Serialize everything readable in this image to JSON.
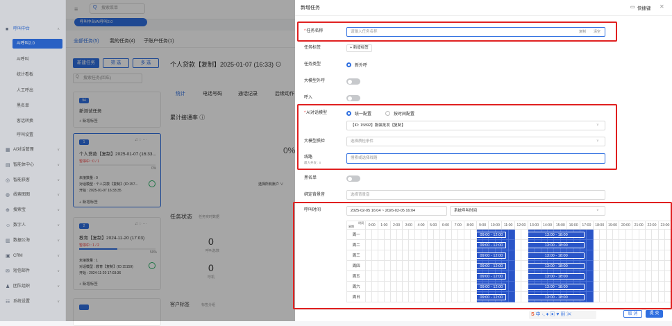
{
  "topbar": {
    "search_placeholder": "搜索菜单",
    "breadcrumb": "呼叫中台/AI呼叫2.0"
  },
  "sidebar": {
    "group": "呼叫中台",
    "subitems": [
      "AI呼叫2.0",
      "AI呼叫",
      "统计看板",
      "人工呼出",
      "黑名单",
      "客话转换",
      "呼叫设置"
    ],
    "items": [
      "AI对话管理",
      "智能体中心",
      "智能获客",
      "线索图图",
      "搜索宝",
      "数字人",
      "数据公海",
      "CRM",
      "短信邮件",
      "团队组织",
      "系统设置"
    ]
  },
  "bg": {
    "tabs": [
      "全部任务(5)",
      "我的任务(4)",
      "子账户任务(1)"
    ],
    "new_task": "新建任务",
    "filter": "筛 选",
    "multi": "多 选",
    "search_placeholder": "搜索任务(回车)",
    "card1": {
      "badge": "94",
      "title": "新测试任务",
      "add": "+ 新增标签"
    },
    "card2": {
      "badge": "1",
      "title": "个人贷款【复制】2025-01-07 (16:33...",
      "progress": "暂停中 : 0 / 1",
      "pct": "0%",
      "l1": "未接数量 : 0",
      "l2": "对话模型 : 个人贷款【复制】(ID:157...",
      "l3": "开始 : 2025-01-07 16:33:35",
      "add": "+ 新增标签"
    },
    "card3": {
      "badge": "2",
      "title": "教育【复制】2024-11-20 (17:03)",
      "progress": "暂停中 : 1 / 2",
      "pct": "50%",
      "l1": "未接数量 : 1",
      "l2": "对话模型 : 教育【复制】(ID:15159)",
      "l3": "开始 : 2024-11-20 17:03:36",
      "add": "+ 新增标签"
    },
    "detail_title": "个人贷款【复制】2025-01-07 (16:33) ⊙",
    "detail_tabs": [
      "统计",
      "电话号码",
      "通话记录",
      "后续动作"
    ],
    "stat_title": "累计接通率 ⓘ",
    "pct0": "0%",
    "task_status": "任务状态",
    "task_status_sub": "任务实时数据",
    "n1": "0",
    "n1_lbl": "呼叫总数",
    "n2": "0",
    "n2_lbl": "呼机",
    "customer_tag": "客户标签",
    "customer_tag_sub": "标签分组",
    "select_all": "选择所有账户 ∨"
  },
  "panel": {
    "title": "新增任务",
    "shortcut": "快捷键",
    "close": "✕",
    "task_name_label": "任务名称",
    "task_name_placeholder": "请输入任务名称",
    "copy": "复制",
    "clear": "清空",
    "task_tag_label": "任务标签",
    "task_tag_btn": "+ 新增标签",
    "task_type_label": "任务类型",
    "task_type_value": "新外呼",
    "llm_call_label": "大模型外呼",
    "inbound_label": "呼入",
    "ai_model_label": "AI对话模型",
    "radio_unified": "统一配置",
    "radio_by_time": "按时间配置",
    "model_value": "【ID: 15892】服装批发【复制】",
    "llm_qc_label": "大模型质检",
    "llm_qc_placeholder": "选择质检条件",
    "line_label": "线路",
    "line_sub": "最大并发 : 0",
    "line_placeholder": "搜索或选择线路",
    "blacklist_label": "黑名单",
    "bind_bg_label": "绑定背景音",
    "bind_bg_placeholder": "选择背景音",
    "call_time_label": "呼叫时间",
    "date_range": "2025-02-05 16:04  ~  2026-02-05 16:04",
    "call_time_select": "系统呼叫时间",
    "grid_corner_time": "时间",
    "grid_corner_week": "星期",
    "hours": [
      "0:00",
      "1:00",
      "2:00",
      "3:00",
      "4:00",
      "5:00",
      "6:00",
      "7:00",
      "8:00",
      "9:00",
      "10:00",
      "11:00",
      "12:00",
      "13:00",
      "14:00",
      "15:00",
      "16:00",
      "17:00",
      "18:00",
      "19:00",
      "20:00",
      "21:00",
      "22:00",
      "23:00"
    ],
    "days": [
      "周一",
      "周二",
      "周三",
      "周四",
      "周五",
      "周六",
      "周日"
    ],
    "slot_am": "09:00 - 12:00",
    "slot_pm": "13:00 - 18:00",
    "cancel": "取 消",
    "submit": "提 交"
  },
  "colors": {
    "primary": "#2f6fe0",
    "highlight_border": "#e02020",
    "selected_cell": "#2a55c8"
  }
}
